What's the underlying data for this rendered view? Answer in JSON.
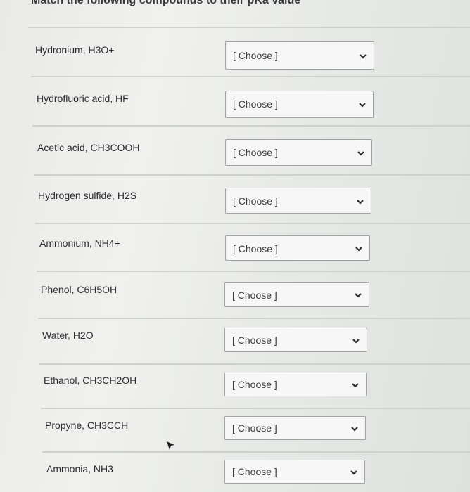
{
  "question": {
    "title": "Match the following compounds to their pKa value"
  },
  "rows": [
    {
      "label": "Hydronium, H3O+",
      "select_value": "[ Choose ]"
    },
    {
      "label": "Hydrofluoric acid, HF",
      "select_value": "[ Choose ]"
    },
    {
      "label": "Acetic acid, CH3COOH",
      "select_value": "[ Choose ]"
    },
    {
      "label": "Hydrogen sulfide, H2S",
      "select_value": "[ Choose ]"
    },
    {
      "label": "Ammonium, NH4+",
      "select_value": "[ Choose ]"
    },
    {
      "label": "Phenol, C6H5OH",
      "select_value": "[ Choose ]"
    },
    {
      "label": "Water, H2O",
      "select_value": "[ Choose ]"
    },
    {
      "label": "Ethanol, CH3CH2OH",
      "select_value": "[ Choose ]"
    },
    {
      "label": "Propyne, CH3CCH",
      "select_value": "[ Choose ]"
    },
    {
      "label": "Ammonia, NH3",
      "select_value": "[ Choose ]"
    }
  ]
}
